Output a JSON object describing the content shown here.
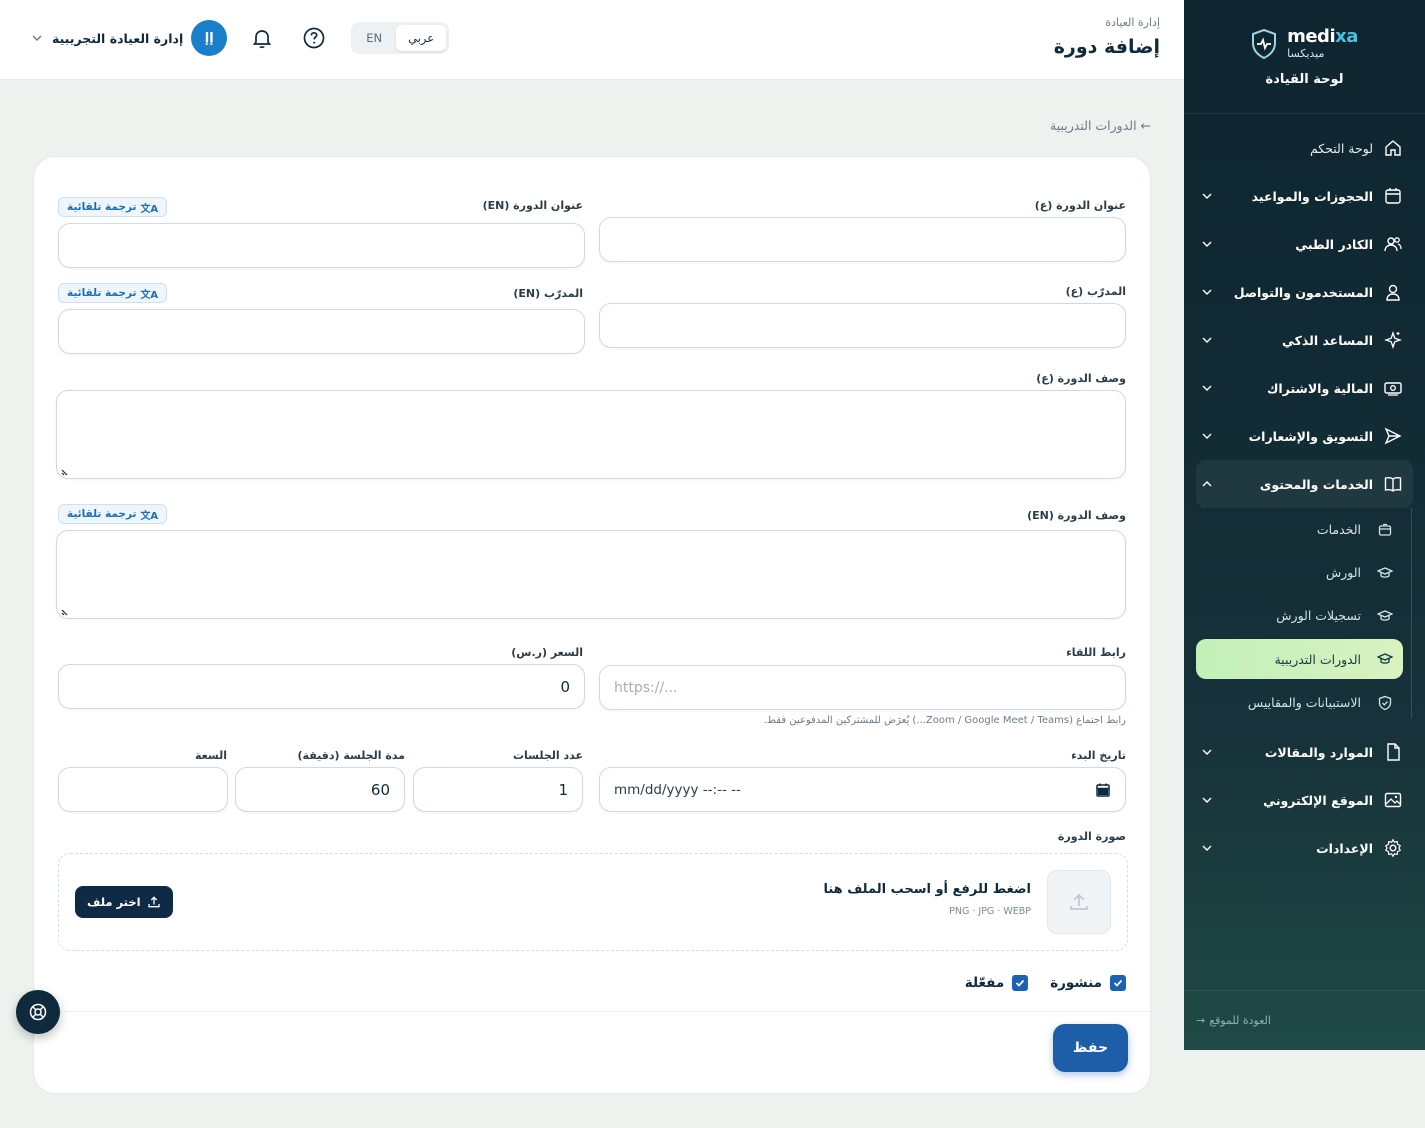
{
  "brand": {
    "name_en_main": "medi",
    "name_en_accent": "xa",
    "name_ar": "ميديكسا",
    "subtitle": "لوحة القيادة"
  },
  "sidebar": {
    "items": [
      {
        "label": "لوحة التحكم",
        "icon": "home-icon"
      },
      {
        "label": "الحجوزات والمواعيد",
        "icon": "calendar-icon"
      },
      {
        "label": "الكادر الطبي",
        "icon": "users-icon"
      },
      {
        "label": "المستخدمون والتواصل",
        "icon": "user-icon"
      },
      {
        "label": "المساعد الذكي",
        "icon": "sparkles-icon"
      },
      {
        "label": "المالية والاشتراك",
        "icon": "money-icon"
      },
      {
        "label": "التسويق والإشعارات",
        "icon": "send-icon"
      },
      {
        "label": "الخدمات والمحتوى",
        "icon": "book-icon"
      },
      {
        "label": "الموارد والمقالات",
        "icon": "file-icon"
      },
      {
        "label": "الموقع الإلكتروني",
        "icon": "image-icon"
      },
      {
        "label": "الإعدادات",
        "icon": "gear-icon"
      }
    ],
    "sub_items": [
      {
        "label": "الخدمات",
        "icon": "box-icon"
      },
      {
        "label": "الورش",
        "icon": "graduation-cap-icon"
      },
      {
        "label": "تسجيلات الورش",
        "icon": "graduation-cap-icon"
      },
      {
        "label": "الدورات التدريبية",
        "icon": "graduation-cap-icon",
        "active": true
      },
      {
        "label": "الاستبيانات والمقاييس",
        "icon": "shield-check-icon"
      }
    ],
    "footer_link": "العودة للموقع"
  },
  "topbar": {
    "breadcrumb": "إدارة العيادة",
    "title": "إضافة دورة",
    "lang_ar": "عربي",
    "lang_en": "EN",
    "user_name": "إدارة العيادة التجريبية",
    "avatar_initials": "إإ"
  },
  "back_link": "← الدورات التدريبية",
  "form": {
    "title_ar_label": "عنوان الدورة (ع)",
    "title_en_label": "عنوان الدورة (EN)",
    "trainer_ar_label": "المدرّب (ع)",
    "trainer_en_label": "المدرّب (EN)",
    "desc_ar_label": "وصف الدورة (ع)",
    "desc_en_label": "وصف الدورة (EN)",
    "auto_translate": "ترجمة تلقائية",
    "meeting_label": "رابط اللقاء",
    "meeting_placeholder": "https://...",
    "meeting_hint": "رابط اجتماع (Zoom / Google Meet / Teams...) يُعرَض للمشتركين المدفوعين فقط.",
    "price_label": "السعر (ر.س)",
    "price_value": "0",
    "start_date_label": "تاريخ البدء",
    "start_date_placeholder": "mm/dd/yyyy --:-- --",
    "sessions_label": "عدد الجلسات",
    "sessions_value": "1",
    "duration_label": "مدة الجلسة (دقيقة)",
    "duration_value": "60",
    "capacity_label": "السعة",
    "capacity_value": "",
    "image_label": "صورة الدورة",
    "upload_title": "اضغط للرفع أو اسحب الملف هنا",
    "upload_formats": "PNG · JPG · WEBP",
    "choose_file": "اختر ملف",
    "published_label": "منشورة",
    "active_label": "مفعّلة",
    "published_checked": true,
    "active_checked": true,
    "save_label": "حفظ"
  },
  "colors": {
    "primary": "#1d5ea8",
    "sidebar_bg": "#0f2530",
    "active_item": "#c2f0b8",
    "avatar": "#1a7fc9"
  }
}
